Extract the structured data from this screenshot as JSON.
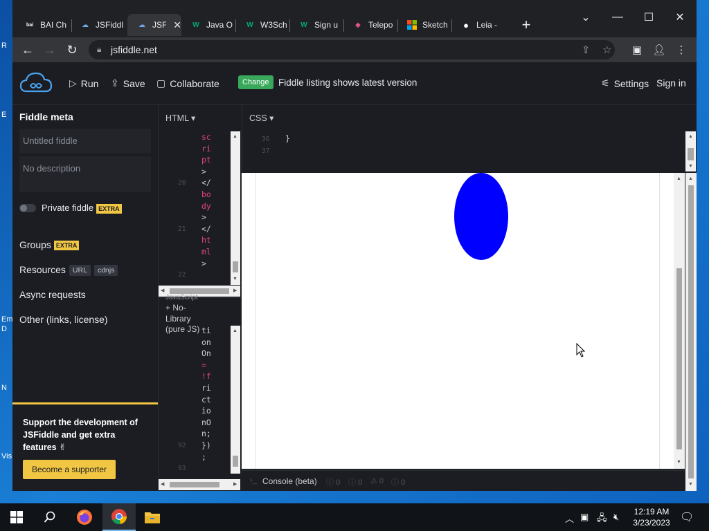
{
  "desktop": {
    "fragments": [
      "R",
      "E",
      "Em",
      "D",
      "N",
      "Vis"
    ]
  },
  "browser": {
    "tabs": [
      {
        "title": "BAI Ch",
        "favicon": "bai-logo-icon",
        "fav_glyph": "bai",
        "fav_color": "#ffffff"
      },
      {
        "title": "JSFiddl",
        "favicon": "jsfiddle-cloud-icon",
        "fav_glyph": "☁",
        "fav_color": "#6ea9e8"
      },
      {
        "title": "JSFi",
        "favicon": "jsfiddle-cloud-icon",
        "fav_glyph": "☁",
        "fav_color": "#6ea9e8",
        "active": true
      },
      {
        "title": "Java O",
        "favicon": "w3schools-icon",
        "fav_glyph": "W",
        "fav_color": "#04aa6d"
      },
      {
        "title": "W3Sch",
        "favicon": "w3schools-icon",
        "fav_glyph": "W",
        "fav_color": "#04aa6d"
      },
      {
        "title": "Sign u",
        "favicon": "w3schools-icon",
        "fav_glyph": "W",
        "fav_color": "#04aa6d"
      },
      {
        "title": "Telepo",
        "favicon": "teleport-icon",
        "fav_glyph": "◆",
        "fav_color": "#e0568b"
      },
      {
        "title": "Sketch",
        "favicon": "microsoft-icon",
        "fav_glyph": "▦",
        "fav_color": "#f25022"
      },
      {
        "title": "Leia - ",
        "favicon": "leia-icon",
        "fav_glyph": "●",
        "fav_color": "#ffffff"
      }
    ],
    "close_glyph": "✕",
    "newtab_glyph": "+",
    "address": "jsfiddle.net"
  },
  "jsfiddle": {
    "run_label": "Run",
    "save_label": "Save",
    "collaborate_label": "Collaborate",
    "change_badge": "Change",
    "listing_text": "Fiddle listing shows latest version",
    "settings_label": "Settings",
    "signin_label": "Sign in"
  },
  "sidebar": {
    "title": "Fiddle meta",
    "title_placeholder": "Untitled fiddle",
    "description_placeholder": "No description",
    "private_label": "Private fiddle",
    "extra_badge": "EXTRA",
    "groups_label": "Groups",
    "resources_label": "Resources",
    "url_badge": "URL",
    "cdnjs_badge": "cdnjs",
    "async_label": "Async requests",
    "other_label": "Other (links, license)",
    "support_text": "Support the development of JSFiddle and get extra features ✌",
    "supporter_button": "Become a supporter"
  },
  "editors": {
    "html_label": "HTML ▾",
    "css_label": "CSS ▾",
    "html_lines": [
      {
        "text": "sc",
        "color": "#e2467a"
      },
      {
        "text": "ri",
        "color": "#e2467a"
      },
      {
        "text": "pt",
        "color": "#e2467a"
      },
      {
        "text": ">",
        "color": "#c8ccd4"
      },
      {
        "text": "</",
        "color": "#c8ccd4"
      },
      {
        "text": "bo",
        "color": "#e2467a"
      },
      {
        "text": "dy",
        "color": "#e2467a"
      },
      {
        "text": ">",
        "color": "#c8ccd4"
      },
      {
        "text": "</",
        "color": "#c8ccd4"
      },
      {
        "text": "ht",
        "color": "#e2467a"
      },
      {
        "text": "ml",
        "color": "#e2467a"
      },
      {
        "text": ">",
        "color": "#c8ccd4"
      }
    ],
    "html_line_numbers": [
      {
        "n": "20",
        "row": 4
      },
      {
        "n": "21",
        "row": 8
      },
      {
        "n": "22",
        "row": 12
      }
    ],
    "css_lines": [
      {
        "num": "36",
        "text": "}"
      },
      {
        "num": "37",
        "text": ""
      }
    ],
    "js_label": "+ No-Library (pure JS)",
    "js_label_fragment": "JavaScript",
    "js_lines": [
      {
        "text": "ti",
        "color": "#c8ccd4"
      },
      {
        "text": "on",
        "color": "#c8ccd4"
      },
      {
        "text": "On",
        "color": "#c8ccd4"
      },
      {
        "text": "=",
        "color": "#e2467a"
      },
      {
        "text": "!f",
        "color": "#e2467a"
      },
      {
        "text": "ri",
        "color": "#c8ccd4"
      },
      {
        "text": "ct",
        "color": "#c8ccd4"
      },
      {
        "text": "io",
        "color": "#c8ccd4"
      },
      {
        "text": "nO",
        "color": "#c8ccd4"
      },
      {
        "text": "n;",
        "color": "#c8ccd4"
      },
      {
        "text": "})",
        "color": "#c8ccd4"
      },
      {
        "text": ";",
        "color": "#c8ccd4"
      }
    ],
    "js_line_numbers": [
      {
        "n": "92",
        "row": 10
      },
      {
        "n": "93",
        "row": 12
      }
    ]
  },
  "result": {
    "shape_color": "#0000ff"
  },
  "console": {
    "label": "Console (beta)",
    "counts": [
      "0",
      "0",
      "0",
      "0"
    ]
  },
  "taskbar": {
    "time": "12:19 AM",
    "date": "3/23/2023"
  }
}
